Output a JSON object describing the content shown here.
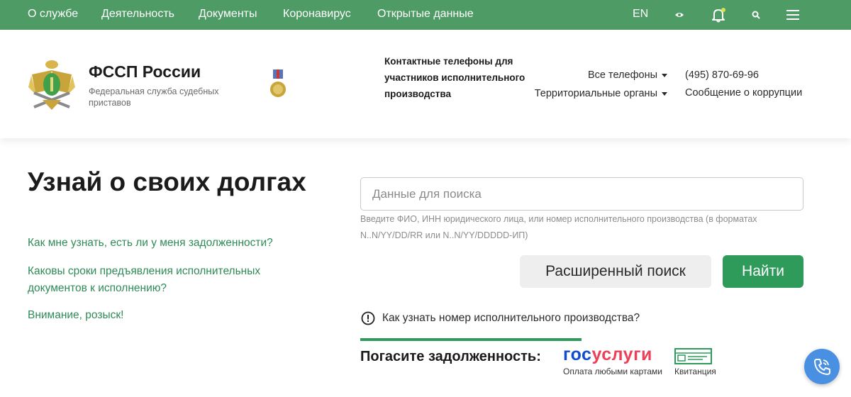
{
  "topnav": {
    "items": [
      "О службе",
      "Деятельность",
      "Документы",
      "Коронавирус",
      "Открытые данные"
    ],
    "lang": "EN",
    "icons": [
      "eye-icon",
      "bell-icon",
      "search-icon",
      "menu-icon"
    ],
    "bg_color": "#4e9b66",
    "notification_dot_color": "#d8e24a"
  },
  "header": {
    "title": "ФССП России",
    "subtitle": "Федеральная служба судебных приставов",
    "contact_title": "Контактные телефоны для участников исполнительного производства",
    "dropdowns": [
      "Все телефоны",
      "Территориальные органы"
    ],
    "phone": "(495) 870-69-96",
    "corruption_link": "Сообщение о коррупции"
  },
  "main": {
    "title": "Узнай о своих долгах",
    "links": [
      "Как мне узнать, есть ли у меня задолженности?",
      "Каковы сроки предъявления исполнительных документов к исполнению?",
      "Внимание, розыск!"
    ],
    "search": {
      "placeholder": "Данные для поиска",
      "hint": "Введите ФИО, ИНН юридического лица, или номер исполнительного производства (в форматах N..N/YY/DD/RR или N..N/YY/DDDDD-ИП)"
    },
    "advanced_button": "Расширенный поиск",
    "find_button": "Найти",
    "info_link": "Как узнать номер исполнительного производства?",
    "pay": {
      "title": "Погасите задолженность:",
      "gosuslugi_blue": "гос",
      "gosuslugi_red": "услуги",
      "gosuslugi_caption": "Оплата любыми картами",
      "receipt_caption": "Квитанция"
    }
  },
  "colors": {
    "accent": "#2e9b5b",
    "link": "#2e8b57",
    "gos_blue": "#0d4cd3",
    "gos_red": "#ee3f58",
    "call_button": "#4a90e2"
  }
}
